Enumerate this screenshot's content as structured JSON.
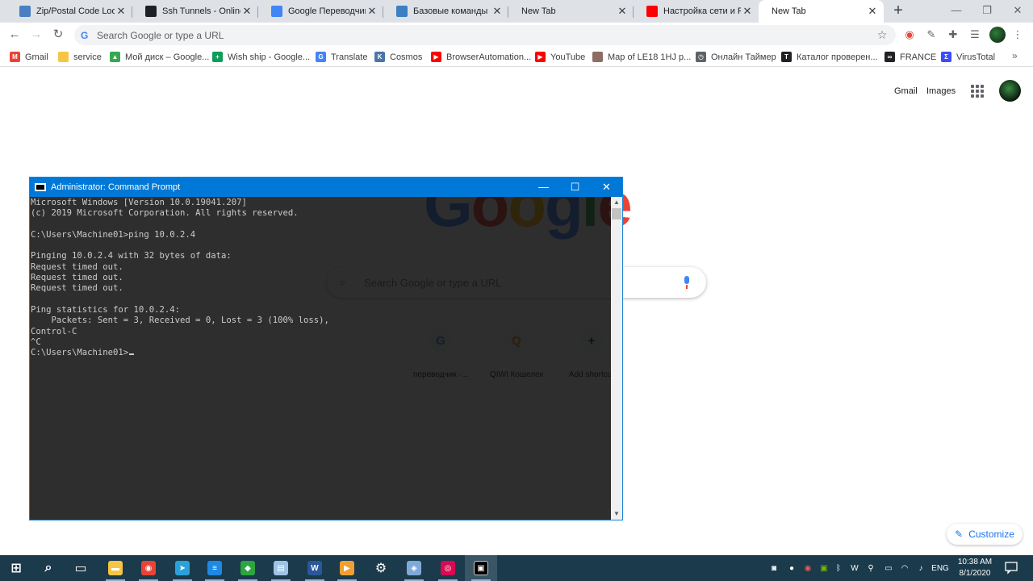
{
  "tabs": [
    {
      "title": "Zip/Postal Code Lookup",
      "favicon": "page-icon",
      "color": "#4a7fc1"
    },
    {
      "title": "Ssh Tunnels - Online SSH",
      "favicon": "infinity-icon",
      "color": "#202124"
    },
    {
      "title": "Google Переводчик",
      "favicon": "translate-icon",
      "color": "#4285f4"
    },
    {
      "title": "Базовые команды Linux",
      "favicon": "gear-icon",
      "color": "#3b7fc4"
    },
    {
      "title": "New Tab",
      "favicon": "",
      "color": ""
    },
    {
      "title": "Настройка сети и RDP",
      "favicon": "youtube-icon",
      "color": "#ff0000"
    },
    {
      "title": "New Tab",
      "favicon": "",
      "color": ""
    }
  ],
  "window_controls": {
    "minimize": "—",
    "maximize": "❐",
    "close": "✕"
  },
  "toolbar": {
    "omnibox_placeholder": "Search Google or type a URL",
    "back": "←",
    "forward": "→",
    "reload": "↻",
    "star": "☆",
    "menu": "⋮"
  },
  "bookmarks": [
    {
      "label": "Gmail",
      "icon": "gmail-icon",
      "color": "#ea4335",
      "glyph": "M"
    },
    {
      "label": "service",
      "icon": "folder-icon",
      "color": "#f6c544",
      "glyph": ""
    },
    {
      "label": "Мой диск – Google...",
      "icon": "drive-icon",
      "color": "#34a853",
      "glyph": "▲"
    },
    {
      "label": "Wish ship - Google...",
      "icon": "sheets-icon",
      "color": "#0f9d58",
      "glyph": "+"
    },
    {
      "label": "Translate",
      "icon": "translate-icon",
      "color": "#4285f4",
      "glyph": "G"
    },
    {
      "label": "Cosmos",
      "icon": "vk-icon",
      "color": "#4a76a8",
      "glyph": "K"
    },
    {
      "label": "BrowserAutomation...",
      "icon": "youtube-icon",
      "color": "#ff0000",
      "glyph": "▶"
    },
    {
      "label": "YouTube",
      "icon": "youtube-icon",
      "color": "#ff0000",
      "glyph": "▶"
    },
    {
      "label": "Map of LE18 1HJ p...",
      "icon": "map-icon",
      "color": "#8d6e63",
      "glyph": ""
    },
    {
      "label": "Онлайн Таймер",
      "icon": "timer-icon",
      "color": "#5f6368",
      "glyph": "◷"
    },
    {
      "label": "Каталог проверен...",
      "icon": "text-icon",
      "color": "#202124",
      "glyph": "T"
    },
    {
      "label": "FRANCE",
      "icon": "infinity-icon",
      "color": "#202124",
      "glyph": "∞"
    },
    {
      "label": "VirusTotal",
      "icon": "virustotal-icon",
      "color": "#394eff",
      "glyph": "Σ"
    }
  ],
  "bookmarks_more": "»",
  "ntp": {
    "gmail_link": "Gmail",
    "images_link": "Images",
    "search_placeholder": "Search Google or type a URL",
    "logo_letters": [
      {
        "ch": "G",
        "color": "#4285f4"
      },
      {
        "ch": "o",
        "color": "#ea4335"
      },
      {
        "ch": "o",
        "color": "#fbbc05"
      },
      {
        "ch": "g",
        "color": "#4285f4"
      },
      {
        "ch": "l",
        "color": "#34a853"
      },
      {
        "ch": "e",
        "color": "#ea4335"
      }
    ],
    "shortcuts": [
      {
        "label": "переводчик -...",
        "glyph": "G",
        "color": "#4285f4"
      },
      {
        "label": "QIWI Кошелек",
        "glyph": "Q",
        "color": "#ff8c00"
      },
      {
        "label": "Add shortcut",
        "glyph": "+",
        "color": "#202124"
      }
    ],
    "customize_label": "Customize"
  },
  "cmd": {
    "title": "Administrator: Command Prompt",
    "lines": [
      "Microsoft Windows [Version 10.0.19041.207]",
      "(c) 2019 Microsoft Corporation. All rights reserved.",
      "",
      "C:\\Users\\Machine01>ping 10.0.2.4",
      "",
      "Pinging 10.0.2.4 with 32 bytes of data:",
      "Request timed out.",
      "Request timed out.",
      "Request timed out.",
      "",
      "Ping statistics for 10.0.2.4:",
      "    Packets: Sent = 3, Received = 0, Lost = 3 (100% loss),",
      "Control-C",
      "^C"
    ],
    "prompt": "C:\\Users\\Machine01>"
  },
  "taskbar": {
    "apps": [
      {
        "name": "start-button",
        "glyph": "⊞",
        "color": "#ffffff"
      },
      {
        "name": "search-icon",
        "glyph": "⌕",
        "color": "#ffffff"
      },
      {
        "name": "task-view-icon",
        "glyph": "▭",
        "color": "#ffffff"
      },
      {
        "name": "file-explorer-icon",
        "glyph": "▬",
        "color": "#f6c544"
      },
      {
        "name": "chrome-icon",
        "glyph": "◉",
        "color": "#ea4335"
      },
      {
        "name": "telegram-icon",
        "glyph": "➤",
        "color": "#2aa1da"
      },
      {
        "name": "stacks-icon",
        "glyph": "≡",
        "color": "#1e88e5"
      },
      {
        "name": "green-app-icon",
        "glyph": "◆",
        "color": "#2ba640"
      },
      {
        "name": "notepad-icon",
        "glyph": "▤",
        "color": "#9ec3e6"
      },
      {
        "name": "word-icon",
        "glyph": "W",
        "color": "#2b579a"
      },
      {
        "name": "media-player-icon",
        "glyph": "▶",
        "color": "#f0a030"
      },
      {
        "name": "settings-icon",
        "glyph": "⚙",
        "color": "#ffffff"
      },
      {
        "name": "virtualbox-icon",
        "glyph": "◈",
        "color": "#7fa9d9"
      },
      {
        "name": "debian-icon",
        "glyph": "◎",
        "color": "#d70a53"
      },
      {
        "name": "cmd-icon",
        "glyph": "▣",
        "color": "#000000"
      }
    ],
    "language": "ENG",
    "time": "10:38 AM",
    "date": "8/1/2020"
  }
}
